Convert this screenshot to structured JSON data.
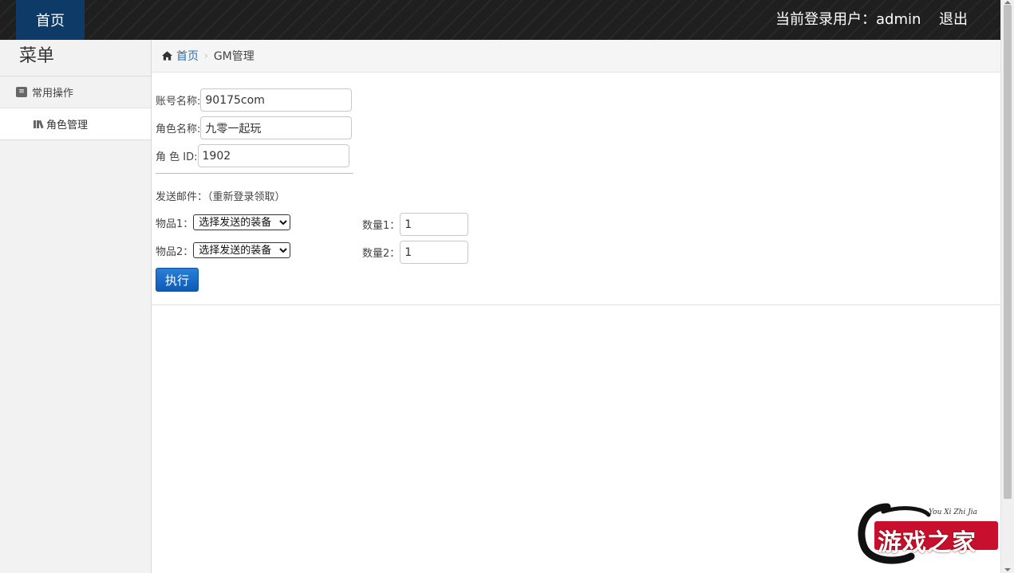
{
  "topbar": {
    "home_label": "首页",
    "user_info": "当前登录用户：admin",
    "logout_label": "退出"
  },
  "sidebar": {
    "title": "菜单",
    "group_label": "常用操作",
    "items": [
      {
        "label": "角色管理"
      }
    ]
  },
  "breadcrumb": {
    "home_label": "首页",
    "current_label": "GM管理"
  },
  "form": {
    "account": {
      "label": "账号名称:",
      "value": "90175com"
    },
    "role_name": {
      "label": "角色名称:",
      "value": "九零一起玩"
    },
    "role_id": {
      "label": "角 色 ID:",
      "value": "1902"
    },
    "mail_title": "发送邮件：（重新登录领取）",
    "items": [
      {
        "label": "物品1：",
        "select_value": "选择发送的装备",
        "qty_label": "数量1：",
        "qty_value": "1"
      },
      {
        "label": "物品2：",
        "select_value": "选择发送的装备",
        "qty_label": "数量2：",
        "qty_value": "1"
      }
    ],
    "submit_label": "执行"
  },
  "watermark": {
    "text": "游戏之家",
    "sub": "You Xi Zhi Jia"
  },
  "colors": {
    "topbar_bg": "#1f1f1f",
    "home_tab_bg": "#0d3a66",
    "button_blue": "#0d5bb8",
    "link_blue": "#2a6fb0"
  }
}
